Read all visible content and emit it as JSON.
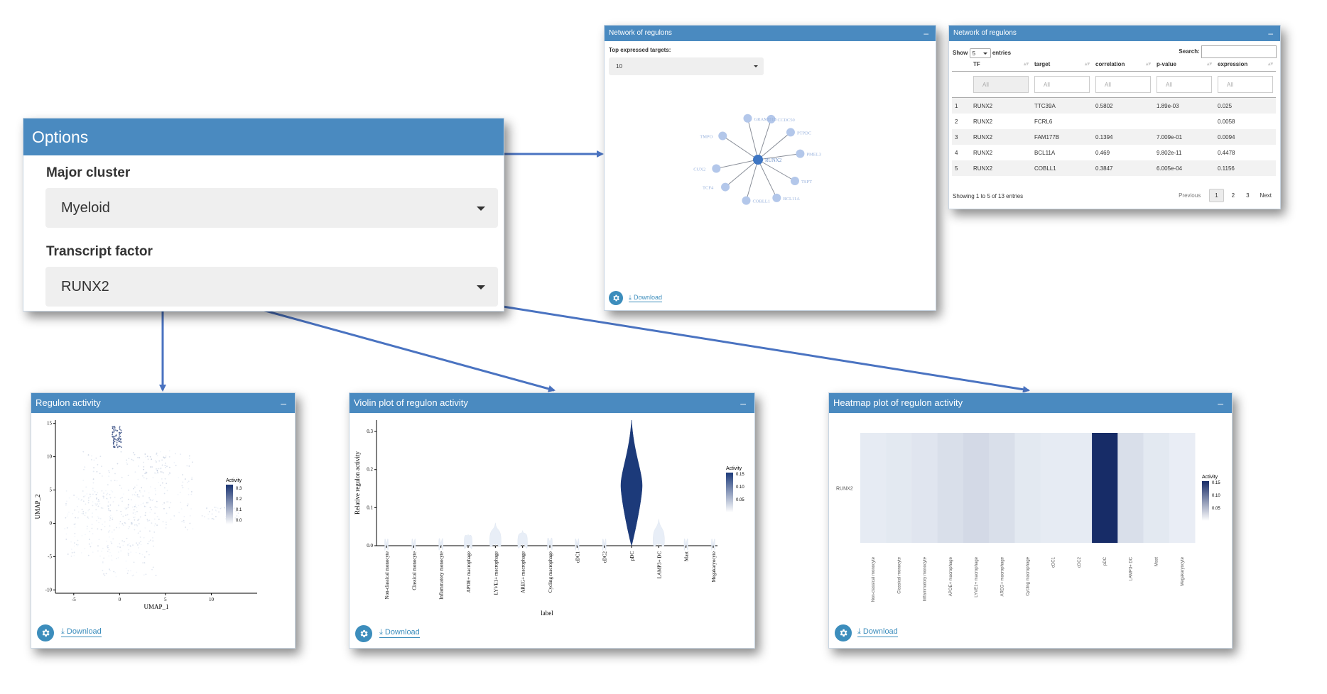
{
  "options": {
    "title": "Options",
    "major_cluster_label": "Major cluster",
    "major_cluster_value": "Myeloid",
    "tf_label": "Transcript factor",
    "tf_value": "RUNX2"
  },
  "network_graph": {
    "title": "Network of regulons",
    "collapse": "–",
    "top_targets_label": "Top expressed targets:",
    "top_targets_value": "10",
    "center_node": "RUNX2",
    "nodes": [
      "CCDC50",
      "GRAMD1B",
      "PTPDC",
      "TMPO",
      "PMEL3",
      "CUX2",
      "TSPT",
      "TCF4",
      "BCL11A",
      "COBLL1"
    ],
    "download": "Download"
  },
  "network_table": {
    "title": "Network of regulons",
    "collapse": "–",
    "show": "Show",
    "entries_value": "5",
    "entries": "entries",
    "search_label": "Search:",
    "columns": [
      "TF",
      "target",
      "correlation",
      "p-value",
      "expression"
    ],
    "filter_placeholder": "All",
    "rows": [
      {
        "n": "1",
        "tf": "RUNX2",
        "target": "TTC39A",
        "correlation": "0.5802",
        "pvalue": "1.89e-03",
        "expression": "0.025"
      },
      {
        "n": "2",
        "tf": "RUNX2",
        "target": "FCRL6",
        "correlation": "",
        "pvalue": "",
        "expression": "0.0058"
      },
      {
        "n": "3",
        "tf": "RUNX2",
        "target": "FAM177B",
        "correlation": "0.1394",
        "pvalue": "7.009e-01",
        "expression": "0.0094"
      },
      {
        "n": "4",
        "tf": "RUNX2",
        "target": "BCL11A",
        "correlation": "0.469",
        "pvalue": "9.802e-11",
        "expression": "0.4478"
      },
      {
        "n": "5",
        "tf": "RUNX2",
        "target": "COBLL1",
        "correlation": "0.3847",
        "pvalue": "6.005e-04",
        "expression": "0.1156"
      }
    ],
    "info": "Showing 1 to 5 of 13 entries",
    "previous": "Previous",
    "pages": [
      "1",
      "2",
      "3"
    ],
    "next": "Next"
  },
  "regulon_panel": {
    "title": "Regulon activity",
    "collapse": "–",
    "download": "Download"
  },
  "violin_panel": {
    "title": "Violin plot of regulon activity",
    "collapse": "–",
    "download": "Download"
  },
  "heatmap_panel": {
    "title": "Heatmap plot of regulon activity",
    "collapse": "–",
    "download": "Download"
  },
  "chart_data": [
    {
      "type": "scatter",
      "xlabel": "UMAP_1",
      "ylabel": "UMAP_2",
      "xticks": [
        -5,
        0,
        5,
        10
      ],
      "yticks": [
        -10,
        -5,
        0,
        5,
        10,
        15
      ],
      "xlim": [
        -7,
        15
      ],
      "ylim": [
        -10.5,
        15.5
      ],
      "legend_title": "Activity",
      "legend_ticks": [
        "0.3",
        "0.2",
        "0.1",
        "0.0"
      ],
      "color_low": "#f0f5fb",
      "color_high": "#1a3472"
    },
    {
      "type": "area",
      "xlabel": "label",
      "ylabel": "Relative regulon activity",
      "ylim": [
        0,
        0.33
      ],
      "yticks": [
        "0.0",
        "0.1",
        "0.2",
        "0.3"
      ],
      "categories": [
        "Non-classical monocyte",
        "Classical monocyte",
        "Inflammatory monocyte",
        "APOE+ macrophage",
        "LYVE1+ macrophage",
        "AREG+ macrophage",
        "Cycling macrophage",
        "cDC1",
        "cDC2",
        "pDC",
        "LAMP3+ DC",
        "Mast",
        "Megakaryocyte"
      ],
      "values": [
        0.004,
        0.005,
        0.008,
        0.03,
        0.06,
        0.04,
        0.012,
        0.006,
        0.004,
        0.33,
        0.07,
        0.006,
        0.004
      ],
      "legend_title": "Activity",
      "legend_ticks": [
        "0.15",
        "0.10",
        "0.05"
      ]
    },
    {
      "type": "heatmap",
      "row_label": "RUNX2",
      "categories": [
        "Non-classical monocyte",
        "Classical monocyte",
        "Inflammatory monocyte",
        "APOE+ macrophage",
        "LYVE1+ macrophage",
        "AREG+ macrophage",
        "Cycling macrophage",
        "cDC1",
        "cDC2",
        "pDC",
        "LAMP3+ DC",
        "Mast",
        "Megakaryocyte"
      ],
      "values": [
        0.01,
        0.012,
        0.015,
        0.02,
        0.025,
        0.02,
        0.012,
        0.01,
        0.01,
        0.17,
        0.02,
        0.012,
        0.008
      ],
      "legend_title": "Activity",
      "legend_ticks": [
        "0.15",
        "0.10",
        "0.05"
      ],
      "color_low": "#f3f7fc",
      "color_high": "#172c67"
    }
  ]
}
